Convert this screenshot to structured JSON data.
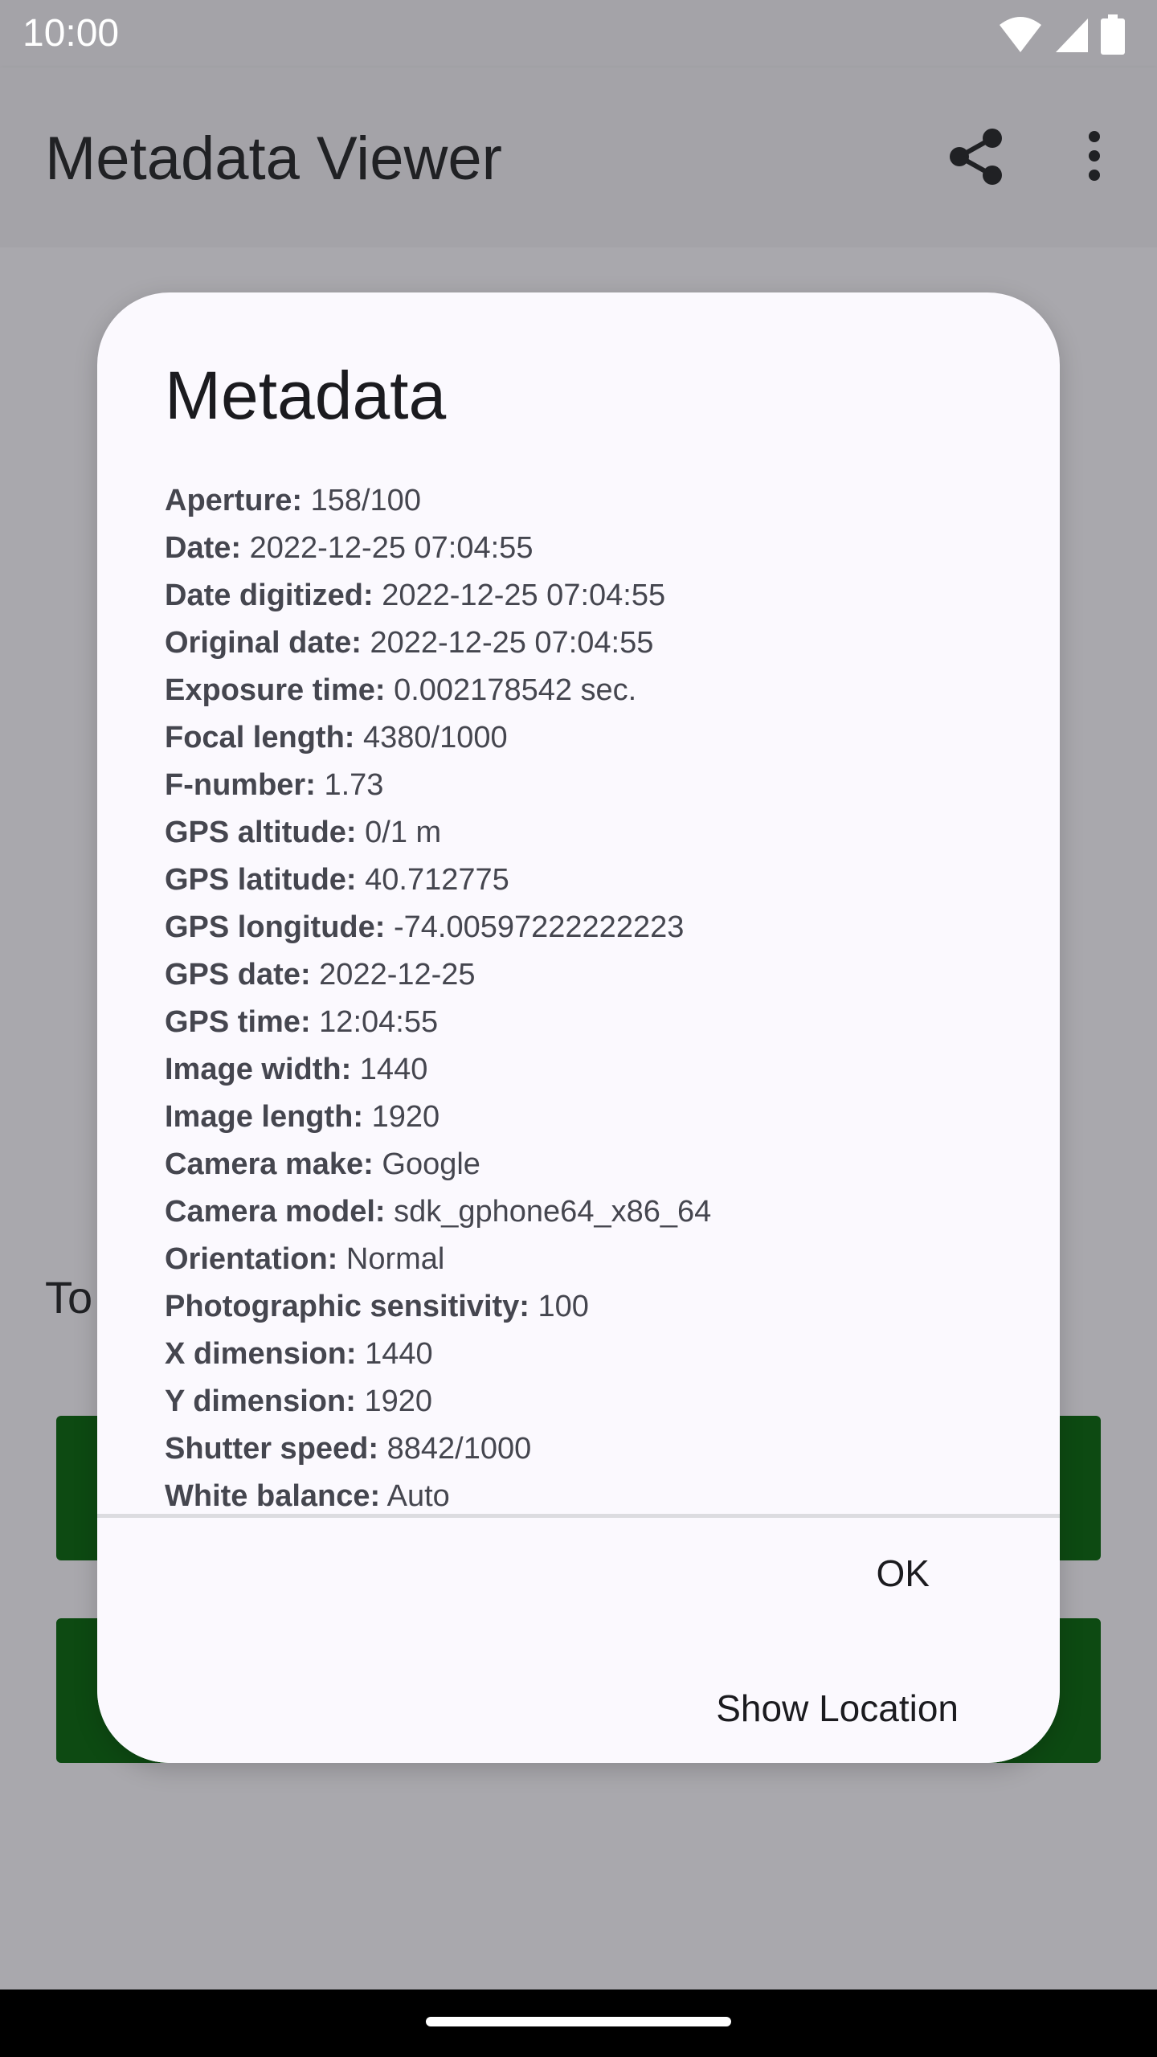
{
  "status": {
    "time": "10:00"
  },
  "app": {
    "title": "Metadata Viewer",
    "icons": [
      "share-icon",
      "more-vert-icon"
    ],
    "background_text": "To",
    "background_buttons": [
      "",
      ""
    ]
  },
  "dialog": {
    "title": "Metadata",
    "items": [
      {
        "label": "Aperture:",
        "value": "158/100"
      },
      {
        "label": "Date:",
        "value": "2022-12-25 07:04:55"
      },
      {
        "label": "Date digitized:",
        "value": "2022-12-25 07:04:55"
      },
      {
        "label": "Original date:",
        "value": "2022-12-25 07:04:55"
      },
      {
        "label": "Exposure time:",
        "value": "0.002178542 sec."
      },
      {
        "label": "Focal length:",
        "value": "4380/1000"
      },
      {
        "label": "F-number:",
        "value": "1.73"
      },
      {
        "label": "GPS altitude:",
        "value": "0/1 m"
      },
      {
        "label": "GPS latitude:",
        "value": "40.712775"
      },
      {
        "label": "GPS longitude:",
        "value": "-74.00597222222223"
      },
      {
        "label": "GPS date:",
        "value": "2022-12-25"
      },
      {
        "label": "GPS time:",
        "value": "12:04:55"
      },
      {
        "label": "Image width:",
        "value": "1440"
      },
      {
        "label": "Image length:",
        "value": "1920"
      },
      {
        "label": "Camera make:",
        "value": "Google"
      },
      {
        "label": "Camera model:",
        "value": "sdk_gphone64_x86_64"
      },
      {
        "label": "Orientation:",
        "value": "Normal"
      },
      {
        "label": "Photographic sensitivity:",
        "value": "100"
      },
      {
        "label": "X dimension:",
        "value": "1440"
      },
      {
        "label": "Y dimension:",
        "value": "1920"
      },
      {
        "label": "Shutter speed:",
        "value": "8842/1000"
      },
      {
        "label": "White balance:",
        "value": "Auto"
      }
    ],
    "buttons": {
      "ok": "OK",
      "show_location": "Show Location"
    }
  },
  "colors": {
    "scrim": "#a9a8ad",
    "dialog_bg": "#fbf9fe",
    "button_green": "#0d4a12"
  }
}
